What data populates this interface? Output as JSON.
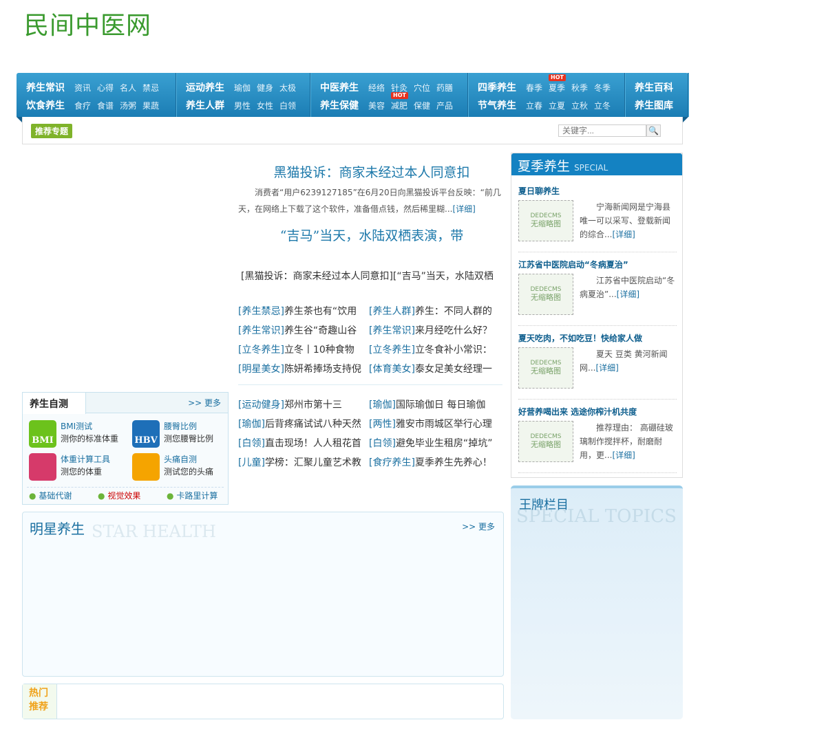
{
  "site": {
    "logo": "民间中医网"
  },
  "nav": [
    {
      "rows": [
        {
          "main": "养生常识",
          "subs": [
            "资讯",
            "心得",
            "名人",
            "禁忌"
          ]
        },
        {
          "main": "饮食养生",
          "subs": [
            "食疗",
            "食谱",
            "汤粥",
            "果蔬"
          ]
        }
      ]
    },
    {
      "rows": [
        {
          "main": "运动养生",
          "subs": [
            "瑜伽",
            "健身",
            "太极"
          ]
        },
        {
          "main": "养生人群",
          "subs": [
            "男性",
            "女性",
            "白领"
          ]
        }
      ]
    },
    {
      "rows": [
        {
          "main": "中医养生",
          "subs": [
            "经络",
            "针灸",
            "穴位",
            "药膳"
          ]
        },
        {
          "main": "养生保健",
          "subs": [
            "美容",
            "减肥",
            "保健",
            "产品"
          ]
        }
      ]
    },
    {
      "rows": [
        {
          "main": "四季养生",
          "subs": [
            "春季",
            "夏季",
            "秋季",
            "冬季"
          ]
        },
        {
          "main": "节气养生",
          "subs": [
            "立春",
            "立夏",
            "立秋",
            "立冬"
          ]
        }
      ]
    },
    {
      "rows": [
        {
          "main": "养生百科",
          "subs": []
        },
        {
          "main": "养生图库",
          "subs": []
        }
      ]
    }
  ],
  "hot_badge": "HOT",
  "subbar": {
    "tag": "推荐专题",
    "search_placeholder": "关键字..."
  },
  "headline": {
    "title1": "黑猫投诉：商家未经过本人同意扣",
    "summary": "消费者“用户6239127185”在6月20日向黑猫投诉平台反映：“前几天，在网络上下载了这个软件，准备借点钱，然后稀里糊...",
    "more": "[详细]",
    "title2": "“吉马”当天，水陆双栖表演，带",
    "links": "[黑猫投诉：商家未经过本人同意扣][“吉马”当天，水陆双栖"
  },
  "list1": [
    [
      "[养生禁忌]",
      "养生茶也有“饮用"
    ],
    [
      "[养生人群]",
      "养生：不同人群的"
    ],
    [
      "[养生常识]",
      "养生谷“奇趣山谷"
    ],
    [
      "[养生常识]",
      "来月经吃什么好？"
    ],
    [
      "[立冬养生]",
      "立冬丨10种食物"
    ],
    [
      "[立冬养生]",
      "立冬食补小常识："
    ],
    [
      "[明星美女]",
      "陈妍希捧场支持倪"
    ],
    [
      "[体育美女]",
      "泰女足美女经理一"
    ]
  ],
  "list2": [
    [
      "[运动健身]",
      "郑州市第十三"
    ],
    [
      "[瑜伽]",
      "国际瑜伽日 每日瑜伽"
    ],
    [
      "[瑜伽]",
      "后背疼痛试试八种天然"
    ],
    [
      "[两性]",
      "雅安市雨城区举行心理"
    ],
    [
      "[白领]",
      "直击现场！人人租花首"
    ],
    [
      "[白领]",
      "避免毕业生租房“掉坑”"
    ],
    [
      "[儿童]",
      "学榜：汇聚儿童艺术教"
    ],
    [
      "[食疗养生]",
      "夏季养生先养心！"
    ]
  ],
  "selftest": {
    "title": "养生自测",
    "more": ">> 更多",
    "tools": [
      {
        "icon": "BMI",
        "name": "BMI测试",
        "desc": "测你的标准体重"
      },
      {
        "icon": "HBV",
        "name": "腰臀比例",
        "desc": "测您腰臀比例"
      },
      {
        "icon": "",
        "name": "体重计算工具",
        "desc": "测您的体重"
      },
      {
        "icon": "",
        "name": "头痛自测",
        "desc": "测试您的头痛"
      }
    ],
    "links": [
      "基础代谢",
      "视觉效果",
      "卡路里计算"
    ]
  },
  "summer": {
    "title": "夏季养生",
    "en": "SPECIAL",
    "thumb1": "DEDECMS",
    "thumb2": "无缩略图",
    "items": [
      {
        "title": "夏日聊养生",
        "desc": "宁海新闻网是宁海县唯一可以采写、登载新闻的综合..."
      },
      {
        "title": "江苏省中医院启动“冬病夏治”",
        "desc": "江苏省中医院启动“冬病夏治”..."
      },
      {
        "title": "夏天吃肉，不如吃豆！快给家人做",
        "desc": "夏天 豆类 黄河新闻网..."
      },
      {
        "title": "好营养喝出来 选途你榨汁机共度",
        "desc": "推荐理由： 高硼硅玻璃制作搅拌杯，耐磨耐用，更..."
      }
    ],
    "more": "[详细]"
  },
  "wangpai": {
    "title": "王牌栏目",
    "en": "SPECIAL TOPICS"
  },
  "star": {
    "title": "明星养生",
    "en": "STAR HEALTH",
    "more": ">> 更多"
  },
  "hot": {
    "l1": "热门",
    "l2": "推荐"
  }
}
